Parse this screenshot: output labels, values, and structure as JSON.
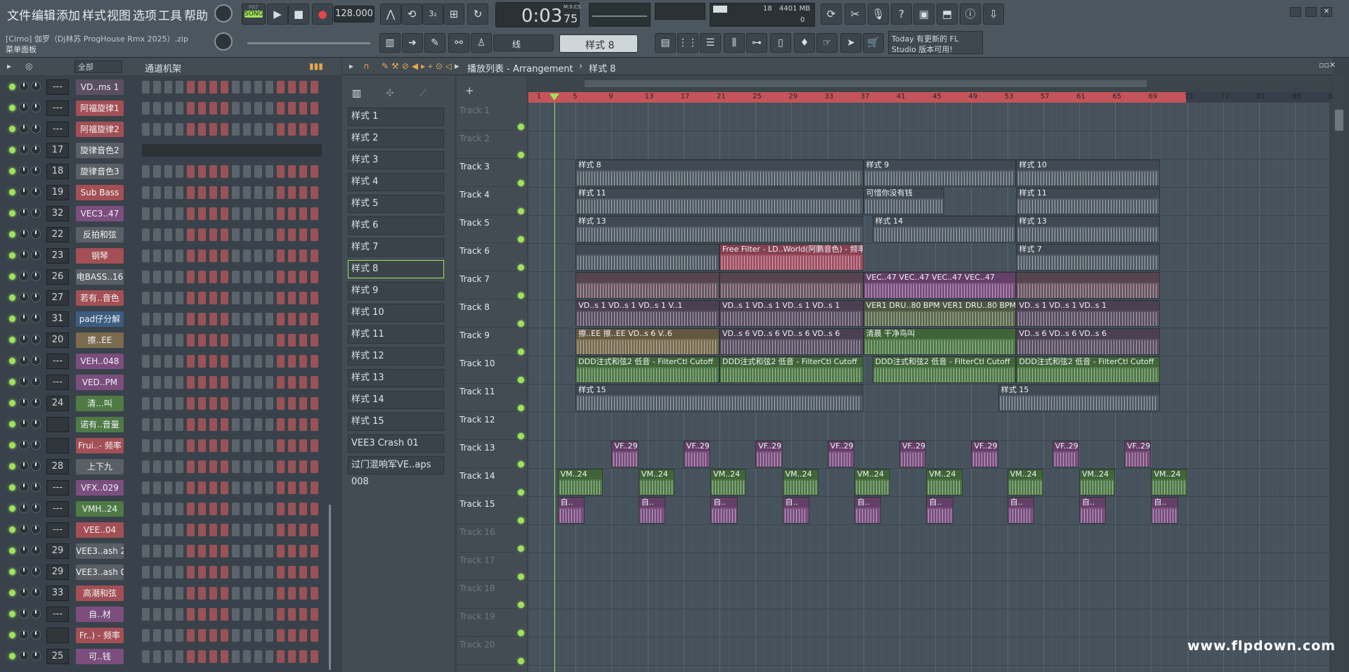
{
  "menu": [
    "文件",
    "编辑",
    "添加",
    "样式",
    "视图",
    "选项",
    "工具",
    "帮助"
  ],
  "transport": {
    "pat": "PAT",
    "song": "SONG",
    "tempo": "128.000",
    "time": "0:03",
    "time_ms": "75",
    "time_label": "M:S:CS",
    "cpu": "18",
    "mem": "4401 MB",
    "voices": "0"
  },
  "project": {
    "file": "[Cirno] 伽罗（Dj林苏 ProgHouse Rmx 2025）.zip",
    "panel": "菜单面板"
  },
  "snap": "线",
  "pattern_select": "样式 8",
  "news": {
    "line1": "Today  有更新的 FL",
    "line2": "Studio 版本可用!"
  },
  "rack": {
    "filter": "全部",
    "title": "通道机架"
  },
  "channels": [
    {
      "num": "---",
      "name": "VD..ms 1",
      "color": "#5b4f63"
    },
    {
      "num": "---",
      "name": "阿福旋律1",
      "color": "#a34f55"
    },
    {
      "num": "---",
      "name": "阿福旋律2",
      "color": "#a34f55"
    },
    {
      "num": "17",
      "name": "旋律音色2",
      "color": "#5a5f66"
    },
    {
      "num": "18",
      "name": "旋律音色3",
      "color": "#5a5f66"
    },
    {
      "num": "19",
      "name": "Sub Bass",
      "color": "#a34f55"
    },
    {
      "num": "32",
      "name": "VEC3..47",
      "color": "#7b4e7e"
    },
    {
      "num": "22",
      "name": "反拍和弦",
      "color": "#5a5f66"
    },
    {
      "num": "23",
      "name": "钢琴",
      "color": "#a34f55"
    },
    {
      "num": "26",
      "name": "电BASS..16",
      "color": "#5a5f66"
    },
    {
      "num": "27",
      "name": "若有..音色",
      "color": "#a34f55"
    },
    {
      "num": "31",
      "name": "pad仔分解",
      "color": "#3c5d80"
    },
    {
      "num": "20",
      "name": "擦..EE",
      "color": "#7a6b4f"
    },
    {
      "num": "---",
      "name": "VEH..048",
      "color": "#7b4e7e"
    },
    {
      "num": "---",
      "name": "VED..PM",
      "color": "#7b4e7e"
    },
    {
      "num": "24",
      "name": "清...叫",
      "color": "#4f7a45"
    },
    {
      "num": "",
      "name": "诺有..音量",
      "color": "#4f7a45"
    },
    {
      "num": "",
      "name": "Frui..- 频率",
      "color": "#a34f55"
    },
    {
      "num": "28",
      "name": "上下九",
      "color": "#5a5f66"
    },
    {
      "num": "---",
      "name": "VFX..029",
      "color": "#7b4e7e"
    },
    {
      "num": "---",
      "name": "VMH..24",
      "color": "#4f7a45"
    },
    {
      "num": "---",
      "name": "VEE..04",
      "color": "#a34f55"
    },
    {
      "num": "29",
      "name": "VEE3..ash 26",
      "color": "#5a5f66"
    },
    {
      "num": "29",
      "name": "VEE3..ash 01",
      "color": "#5a5f66"
    },
    {
      "num": "33",
      "name": "高潮和弦",
      "color": "#a34f55"
    },
    {
      "num": "---",
      "name": "自..材",
      "color": "#7b4e7e"
    },
    {
      "num": "",
      "name": "Fr..) - 频率",
      "color": "#a34f55"
    },
    {
      "num": "25",
      "name": "可..钱",
      "color": "#7b4e7e"
    }
  ],
  "patterns": [
    "样式 1",
    "样式 2",
    "样式 3",
    "样式 4",
    "样式 5",
    "样式 6",
    "样式 7",
    "样式 8",
    "样式 9",
    "样式 10",
    "样式 11",
    "样式 12",
    "样式 13",
    "样式 14",
    "样式 15",
    "VEE3 Crash 01",
    "过门混响军VE..aps 008"
  ],
  "playlist": {
    "title": "播放列表 - Arrangement",
    "pattern": "样式 8"
  },
  "tracks": [
    "Track 1",
    "Track 2",
    "Track 3",
    "Track 4",
    "Track 5",
    "Track 6",
    "Track 7",
    "Track 8",
    "Track 9",
    "Track 10",
    "Track 11",
    "Track 12",
    "Track 13",
    "Track 14",
    "Track 15",
    "Track 16",
    "Track 17",
    "Track 18",
    "Track 19",
    "Track 20"
  ],
  "bars": [
    "1",
    "5",
    "9",
    "13",
    "17",
    "21",
    "25",
    "29",
    "33",
    "37",
    "41",
    "45",
    "49",
    "53",
    "57",
    "61",
    "65",
    "69",
    "73",
    "77",
    "81",
    "85",
    "89"
  ],
  "clips": [
    {
      "t": 2,
      "b": 5,
      "w": 32,
      "label": "样式 8",
      "c": "#4f5a63"
    },
    {
      "t": 2,
      "b": 37,
      "w": 17,
      "label": "样式 9",
      "c": "#4f5a63"
    },
    {
      "t": 2,
      "b": 54,
      "w": 16,
      "label": "样式 10",
      "c": "#4f5a63"
    },
    {
      "t": 3,
      "b": 5,
      "w": 32,
      "label": "样式 11",
      "c": "#4f5a63"
    },
    {
      "t": 3,
      "b": 37,
      "w": 9,
      "label": "可惜你没有钱",
      "c": "#4f5a63"
    },
    {
      "t": 3,
      "b": 54,
      "w": 16,
      "label": "样式 11",
      "c": "#4f5a63"
    },
    {
      "t": 4,
      "b": 5,
      "w": 32,
      "label": "样式 13",
      "c": "#4f5a63"
    },
    {
      "t": 4,
      "b": 38,
      "w": 16,
      "label": "样式 14",
      "c": "#4f5a63"
    },
    {
      "t": 4,
      "b": 54,
      "w": 16,
      "label": "样式 13",
      "c": "#4f5a63"
    },
    {
      "t": 5,
      "b": 5,
      "w": 16,
      "label": "",
      "c": "#4f5a63"
    },
    {
      "t": 5,
      "b": 21,
      "w": 16,
      "label": "Free Filter - LD..World(阿鹏音色) - 频率",
      "c": "#a34f63"
    },
    {
      "t": 5,
      "b": 54,
      "w": 16,
      "label": "样式 7",
      "c": "#4f5a63"
    },
    {
      "t": 6,
      "b": 5,
      "w": 16,
      "label": "",
      "c": "#6a5560"
    },
    {
      "t": 6,
      "b": 21,
      "w": 16,
      "label": "",
      "c": "#6a5560"
    },
    {
      "t": 6,
      "b": 37,
      "w": 17,
      "label": "VEC..47  VEC..47  VEC..47  VEC..47",
      "c": "#7b4e7e"
    },
    {
      "t": 6,
      "b": 54,
      "w": 16,
      "label": "",
      "c": "#6a5560"
    },
    {
      "t": 7,
      "b": 5,
      "w": 16,
      "label": "VD..s 1  VD..s 1  VD..s 1  V..1",
      "c": "#5b4f63"
    },
    {
      "t": 7,
      "b": 21,
      "w": 16,
      "label": "VD..s 1  VD..s 1  VD..s 1  VD..s 1",
      "c": "#5b4f63"
    },
    {
      "t": 7,
      "b": 37,
      "w": 17,
      "label": "VER1 DRU..80 BPM  VER1 DRU..80 BPM",
      "c": "#5d6a4f"
    },
    {
      "t": 7,
      "b": 54,
      "w": 16,
      "label": "VD..s 1  VD..s 1  VD..s 1",
      "c": "#5b4f63"
    },
    {
      "t": 8,
      "b": 5,
      "w": 16,
      "label": "擦..EE  擦..EE  VD..s 6  V..6",
      "c": "#7a6b4f"
    },
    {
      "t": 8,
      "b": 21,
      "w": 16,
      "label": "VD..s 6  VD..s 6  VD..s 6  VD..s 6",
      "c": "#5b4f63"
    },
    {
      "t": 8,
      "b": 37,
      "w": 17,
      "label": "清晨 干净鸟叫",
      "c": "#4f7a45"
    },
    {
      "t": 8,
      "b": 54,
      "w": 16,
      "label": "VD..s 6  VD..s 6  VD..s 6",
      "c": "#5b4f63"
    },
    {
      "t": 9,
      "b": 5,
      "w": 16,
      "label": "DDD注式和弦2 低音 - FilterCtl Cutoff",
      "c": "#4f7a45"
    },
    {
      "t": 9,
      "b": 21,
      "w": 16,
      "label": "DDD注式和弦2 低音 - FilterCtl Cutoff",
      "c": "#4f7a45"
    },
    {
      "t": 9,
      "b": 38,
      "w": 16,
      "label": "DDD注式和弦2 低音 - FilterCtl Cutoff",
      "c": "#4f7a45"
    },
    {
      "t": 9,
      "b": 54,
      "w": 16,
      "label": "DDD注式和弦2 低音 - FilterCtl Cutoff",
      "c": "#4f7a45"
    },
    {
      "t": 10,
      "b": 5,
      "w": 32,
      "label": "样式 15",
      "c": "#4f5a63"
    },
    {
      "t": 10,
      "b": 52,
      "w": 18,
      "label": "样式 15",
      "c": "#4f5a63"
    },
    {
      "t": 12,
      "b": 9,
      "w": 3,
      "label": "VF..29",
      "c": "#7b4e7e"
    },
    {
      "t": 12,
      "b": 17,
      "w": 3,
      "label": "VF..29",
      "c": "#7b4e7e"
    },
    {
      "t": 12,
      "b": 25,
      "w": 3,
      "label": "VF..29",
      "c": "#7b4e7e"
    },
    {
      "t": 12,
      "b": 33,
      "w": 3,
      "label": "VF..29",
      "c": "#7b4e7e"
    },
    {
      "t": 12,
      "b": 41,
      "w": 3,
      "label": "VF..29",
      "c": "#7b4e7e"
    },
    {
      "t": 12,
      "b": 49,
      "w": 3,
      "label": "VF..29",
      "c": "#7b4e7e"
    },
    {
      "t": 12,
      "b": 58,
      "w": 3,
      "label": "VF..29",
      "c": "#7b4e7e"
    },
    {
      "t": 12,
      "b": 66,
      "w": 3,
      "label": "VF..29",
      "c": "#7b4e7e"
    },
    {
      "t": 13,
      "b": 3,
      "w": 5,
      "label": "VM..24",
      "c": "#4f7a45"
    },
    {
      "t": 13,
      "b": 12,
      "w": 4,
      "label": "VM..24",
      "c": "#4f7a45"
    },
    {
      "t": 13,
      "b": 20,
      "w": 4,
      "label": "VM..24",
      "c": "#4f7a45"
    },
    {
      "t": 13,
      "b": 28,
      "w": 4,
      "label": "VM..24",
      "c": "#4f7a45"
    },
    {
      "t": 13,
      "b": 36,
      "w": 4,
      "label": "VM..24",
      "c": "#4f7a45"
    },
    {
      "t": 13,
      "b": 44,
      "w": 4,
      "label": "VM..24",
      "c": "#4f7a45"
    },
    {
      "t": 13,
      "b": 53,
      "w": 4,
      "label": "VM..24",
      "c": "#4f7a45"
    },
    {
      "t": 13,
      "b": 61,
      "w": 4,
      "label": "VM..24",
      "c": "#4f7a45"
    },
    {
      "t": 13,
      "b": 69,
      "w": 4,
      "label": "VM..24",
      "c": "#4f7a45"
    },
    {
      "t": 14,
      "b": 3,
      "w": 3,
      "label": "自..",
      "c": "#7b4e7e"
    },
    {
      "t": 14,
      "b": 12,
      "w": 3,
      "label": "自..",
      "c": "#7b4e7e"
    },
    {
      "t": 14,
      "b": 20,
      "w": 3,
      "label": "自..",
      "c": "#7b4e7e"
    },
    {
      "t": 14,
      "b": 28,
      "w": 3,
      "label": "自..",
      "c": "#7b4e7e"
    },
    {
      "t": 14,
      "b": 36,
      "w": 3,
      "label": "自..",
      "c": "#7b4e7e"
    },
    {
      "t": 14,
      "b": 44,
      "w": 3,
      "label": "自..",
      "c": "#7b4e7e"
    },
    {
      "t": 14,
      "b": 53,
      "w": 3,
      "label": "自..",
      "c": "#7b4e7e"
    },
    {
      "t": 14,
      "b": 61,
      "w": 3,
      "label": "自..",
      "c": "#7b4e7e"
    },
    {
      "t": 14,
      "b": 69,
      "w": 3,
      "label": "自..",
      "c": "#7b4e7e"
    }
  ],
  "watermark": "www.flpdown.com"
}
